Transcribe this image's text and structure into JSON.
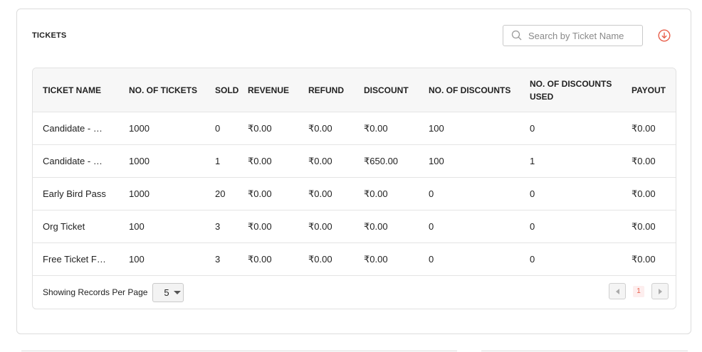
{
  "section_title": "TICKETS",
  "search": {
    "placeholder": "Search by Ticket Name",
    "value": ""
  },
  "colors": {
    "accent": "#e85f4b",
    "border": "#dcdcdc",
    "header_bg": "#f7f7f7"
  },
  "icons": {
    "search": "search-icon",
    "download": "download-circle-icon"
  },
  "table": {
    "headers": [
      "TICKET NAME",
      "NO. OF TICKETS",
      "SOLD",
      "REVENUE",
      "REFUND",
      "DISCOUNT",
      "NO. OF DISCOUNTS",
      "NO. OF DISCOUNTS USED",
      "PAYOUT"
    ],
    "rows": [
      [
        "Candidate - …",
        "1000",
        "0",
        "₹0.00",
        "₹0.00",
        "₹0.00",
        "100",
        "0",
        "₹0.00"
      ],
      [
        "Candidate - …",
        "1000",
        "1",
        "₹0.00",
        "₹0.00",
        "₹650.00",
        "100",
        "1",
        "₹0.00"
      ],
      [
        "Early Bird Pass",
        "1000",
        "20",
        "₹0.00",
        "₹0.00",
        "₹0.00",
        "0",
        "0",
        "₹0.00"
      ],
      [
        "Org Ticket",
        "100",
        "3",
        "₹0.00",
        "₹0.00",
        "₹0.00",
        "0",
        "0",
        "₹0.00"
      ],
      [
        "Free Ticket F…",
        "100",
        "3",
        "₹0.00",
        "₹0.00",
        "₹0.00",
        "0",
        "0",
        "₹0.00"
      ]
    ]
  },
  "footer": {
    "records_label": "Showing Records Per Page",
    "per_page_value": "5",
    "current_page": "1"
  }
}
